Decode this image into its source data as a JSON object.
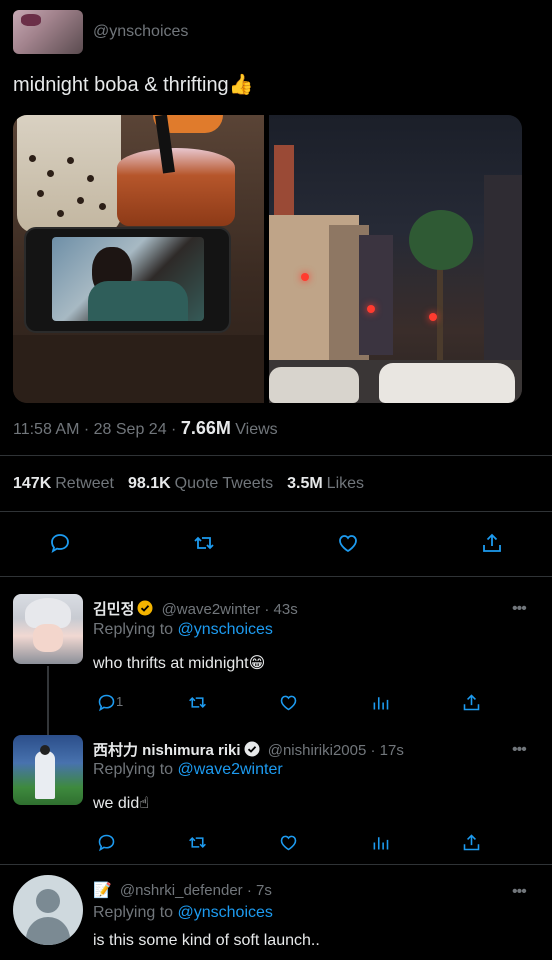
{
  "tweet": {
    "handle": "@ynschoices",
    "text": "midnight boba & thrifting👍",
    "time": "11:58 AM · 28 Sep 24 · ",
    "views_count": "7.66M",
    "views_label": " Views",
    "retweets_count": "147K",
    "retweets_label": "Retweet",
    "quotes_count": "98.1K",
    "quotes_label": "Quote Tweets",
    "likes_count": "3.5M",
    "likes_label": "Likes"
  },
  "replies": [
    {
      "name": "김민정",
      "handle": "@wave2winter",
      "time": " · 43s",
      "replying_prefix": "Replying to ",
      "replying_to": "@ynschoices",
      "text": "who thrifts at midnight😁",
      "reply_count": "1"
    },
    {
      "name": "西村力 nishimura riki",
      "handle": "@nishiriki2005",
      "time": " · 17s",
      "replying_prefix": "Replying to ",
      "replying_to": "@wave2winter",
      "text": "we did☝"
    },
    {
      "name": "📝",
      "handle": "@nshrki_defender",
      "time": " · 7s",
      "replying_prefix": "Replying to ",
      "replying_to": "@ynschoices",
      "text": "is this some kind of soft launch.."
    }
  ],
  "colors": {
    "background": "#000000",
    "text": "#e7e9ea",
    "muted": "#71767b",
    "accent": "#1d9bf0",
    "verified": "#f4b400"
  },
  "icons": [
    "reply-icon",
    "retweet-icon",
    "like-icon",
    "share-icon",
    "views-chart-icon",
    "more-icon",
    "verified-badge-icon"
  ]
}
